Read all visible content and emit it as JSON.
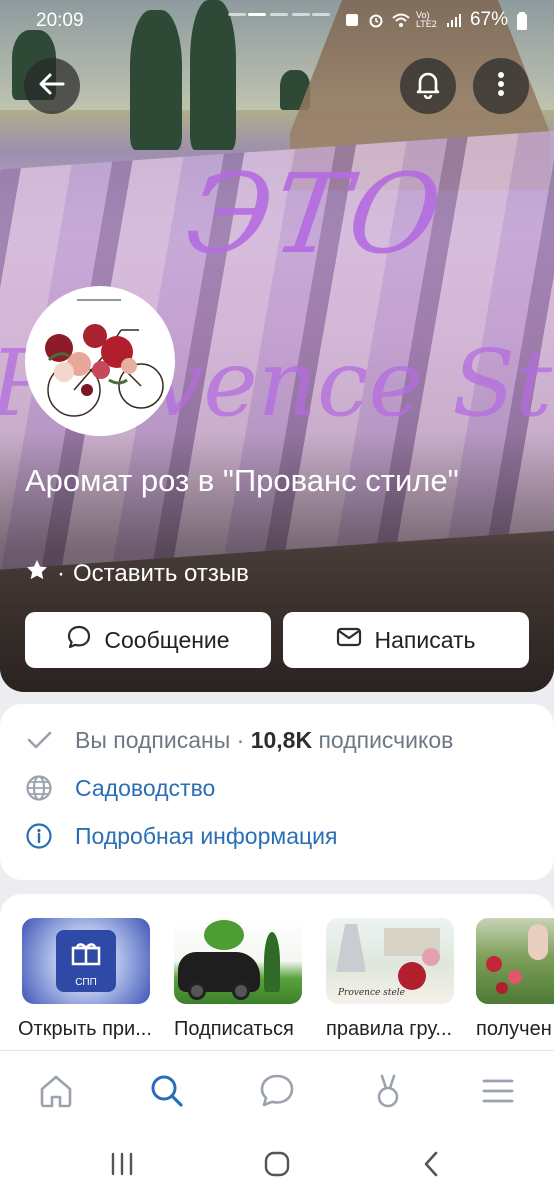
{
  "status_bar": {
    "time": "20:09",
    "battery": "67%",
    "network": "Vo) LTE2"
  },
  "cover": {
    "overlay_word": "ЭТО",
    "overlay_script": "Provence St",
    "accent_color": "#b46ce0"
  },
  "header": {
    "back_icon": "arrow-left-icon",
    "bell_icon": "bell-icon",
    "more_icon": "more-vertical-icon"
  },
  "group": {
    "title": "Аромат роз в  \"Прованс стиле\"",
    "rating_separator": "·",
    "rating_link": "Оставить отзыв"
  },
  "actions": {
    "message_label": "Сообщение",
    "write_label": "Написать"
  },
  "info": {
    "subscribed": "Вы подписаны",
    "separator": "·",
    "followers_count": "10,8K",
    "followers_label": "подписчиков",
    "category": "Садоводство",
    "details": "Подробная информация"
  },
  "links": [
    {
      "label": "Открыть при...",
      "thumb_text": "СПП"
    },
    {
      "label": "Подписаться"
    },
    {
      "label": "правила гру...",
      "thumb_text": "Provence stele"
    },
    {
      "label": "получен"
    }
  ],
  "tabbar": {
    "items": [
      "home-icon",
      "search-icon",
      "chat-icon",
      "clips-icon",
      "menu-icon"
    ],
    "active_color": "#2a6fb5"
  },
  "system_nav": [
    "recents-icon",
    "home-circle-icon",
    "back-chevron-icon"
  ]
}
